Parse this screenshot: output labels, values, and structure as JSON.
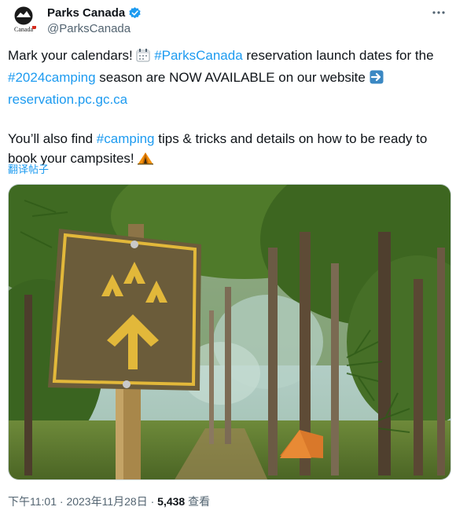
{
  "author": {
    "display_name": "Parks Canada",
    "handle": "@ParksCanada",
    "logo_wordmark": "Canada"
  },
  "tweet": {
    "p1_a": "Mark your calendars! ",
    "hashtag1": "#ParksCanada",
    "p1_b": " reservation launch dates for the ",
    "hashtag2": "#2024camping",
    "p1_c": " season are NOW AVAILABLE on our website ",
    "url": "reservation.pc.gc.ca",
    "p2_a": "You’ll also find ",
    "hashtag3": "#camping",
    "p2_b": " tips & tricks and details on how to be ready to book your campsites! "
  },
  "translate_label": "翻译帖子",
  "footer": {
    "time": "下午11:01",
    "sep1": " · ",
    "date": "2023年11月28日",
    "sep2": " · ",
    "views_count": "5,438",
    "views_label": " 查看"
  },
  "colors": {
    "link": "#1d9bf0",
    "verified": "#1d9bf0",
    "sign_yellow": "#e2b83a",
    "sign_brown": "#6b5c3a"
  },
  "icons": [
    "verified-badge-icon",
    "more-options-icon",
    "calendar-emoji-icon",
    "right-arrow-emoji-icon",
    "tent-emoji-icon"
  ]
}
